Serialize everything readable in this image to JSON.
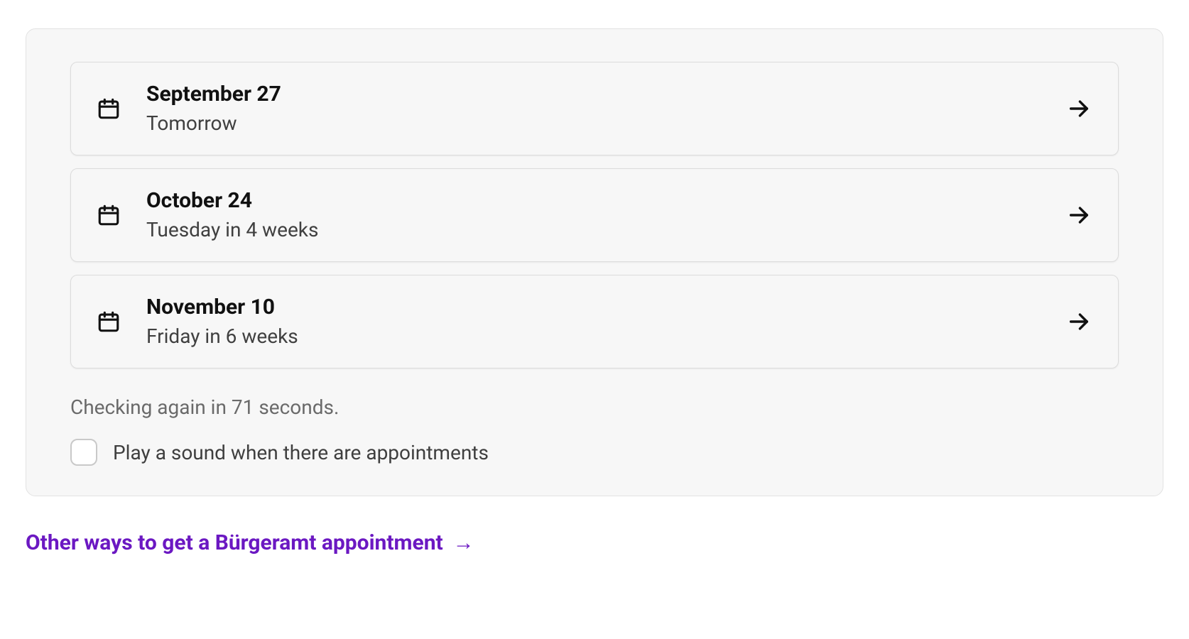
{
  "appointments": [
    {
      "date": "September 27",
      "relative": "Tomorrow"
    },
    {
      "date": "October 24",
      "relative": "Tuesday in 4 weeks"
    },
    {
      "date": "November 10",
      "relative": "Friday in 6 weeks"
    }
  ],
  "status_text": "Checking again in 71 seconds.",
  "sound_checkbox": {
    "label": "Play a sound when there are appointments",
    "checked": false
  },
  "alt_link": {
    "text": "Other ways to get a Bürgeramt appointment",
    "arrow": "→"
  },
  "colors": {
    "link": "#6b18c2"
  }
}
